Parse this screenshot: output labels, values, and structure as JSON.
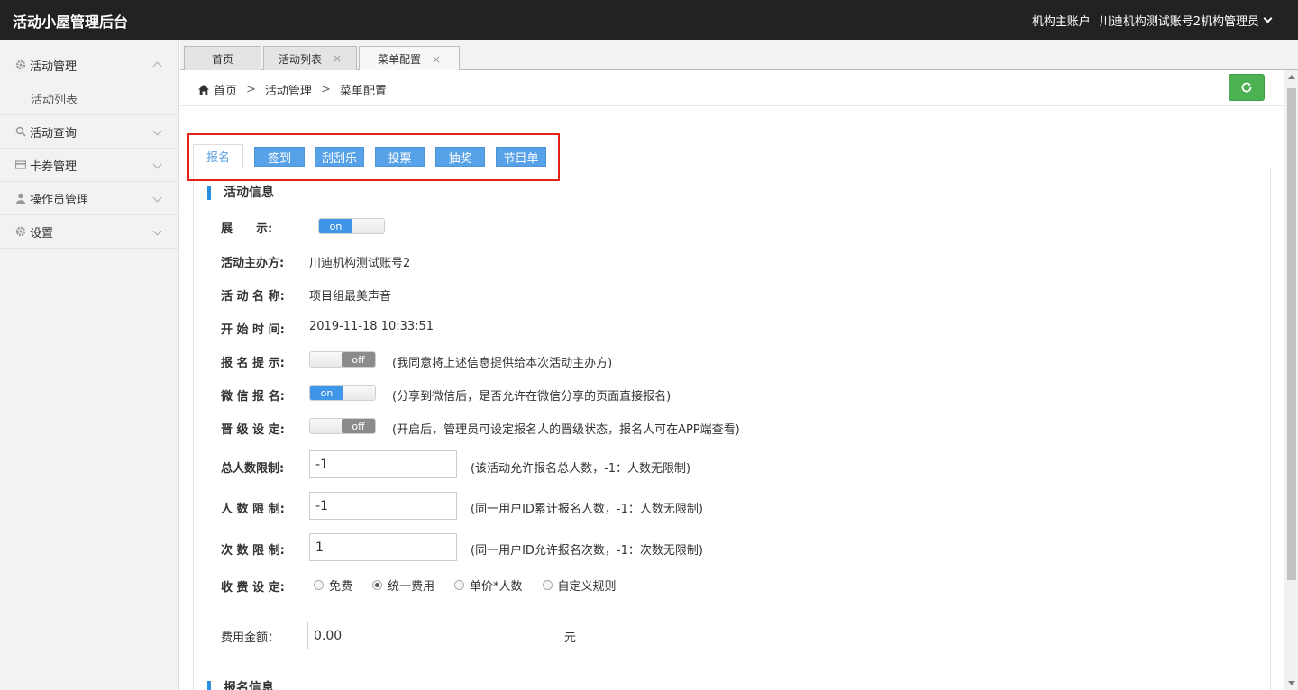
{
  "app": {
    "title": "活动小屋管理后台"
  },
  "user": {
    "account_type": "机构主账户",
    "name": "川迪机构测试账号2机构管理员"
  },
  "sidebar": {
    "items": [
      {
        "label": "活动管理",
        "icon": "gear-icon"
      },
      {
        "label": "活动列表"
      },
      {
        "label": "活动查询",
        "icon": "search-icon"
      },
      {
        "label": "卡券管理",
        "icon": "card-icon"
      },
      {
        "label": "操作员管理",
        "icon": "user-icon"
      },
      {
        "label": "设置",
        "icon": "gear-icon"
      }
    ]
  },
  "page_tabs": [
    {
      "label": "首页"
    },
    {
      "label": "活动列表",
      "close": "×"
    },
    {
      "label": "菜单配置",
      "close": "×"
    }
  ],
  "breadcrumb": {
    "home": "首页",
    "sep": ">",
    "level1": "活动管理",
    "level2": "菜单配置"
  },
  "config_tabs": [
    "报名",
    "签到",
    "刮刮乐",
    "投票",
    "抽奖",
    "节目单"
  ],
  "section1": {
    "title": "活动信息"
  },
  "section2": {
    "title": "报名信息"
  },
  "form": {
    "display": {
      "label": "展　　示:",
      "state": "on"
    },
    "organizer": {
      "label": "活动主办方:",
      "value": "川迪机构测试账号2"
    },
    "activity_name": {
      "label": "活 动 名 称:",
      "value": "项目组最美声音"
    },
    "start_time": {
      "label": "开 始 时 间:",
      "value": "2019-11-18 10:33:51"
    },
    "signup_prompt": {
      "label": "报 名 提 示:",
      "state": "off",
      "note": "(我同意将上述信息提供给本次活动主办方)"
    },
    "wechat_signup": {
      "label": "微 信 报 名:",
      "state": "on",
      "note": "(分享到微信后，是否允许在微信分享的页面直接报名)"
    },
    "promotion": {
      "label": "晋 级 设 定:",
      "state": "off",
      "note": "(开启后，管理员可设定报名人的晋级状态，报名人可在APP端查看)"
    },
    "total_limit": {
      "label": "总人数限制:",
      "value": "-1",
      "note": "(该活动允许报名总人数，-1：人数无限制)"
    },
    "people_limit": {
      "label": "人 数 限 制:",
      "value": "-1",
      "note": "(同一用户ID累计报名人数，-1：人数无限制)"
    },
    "times_limit": {
      "label": "次 数 限 制:",
      "value": "1",
      "note": "(同一用户ID允许报名次数，-1：次数无限制)"
    },
    "fee_setting": {
      "label": "收 费 设 定:",
      "options": [
        "免费",
        "统一费用",
        "单价*人数",
        "自定义规则"
      ],
      "selected": "统一费用"
    },
    "fee_amount": {
      "label": "费用金额：",
      "value": "0.00",
      "unit": "元"
    }
  },
  "colors": {
    "accent": "#56a1e8",
    "topbar": "#222222",
    "refresh": "#4cb151",
    "highlight": "#e2231a"
  }
}
